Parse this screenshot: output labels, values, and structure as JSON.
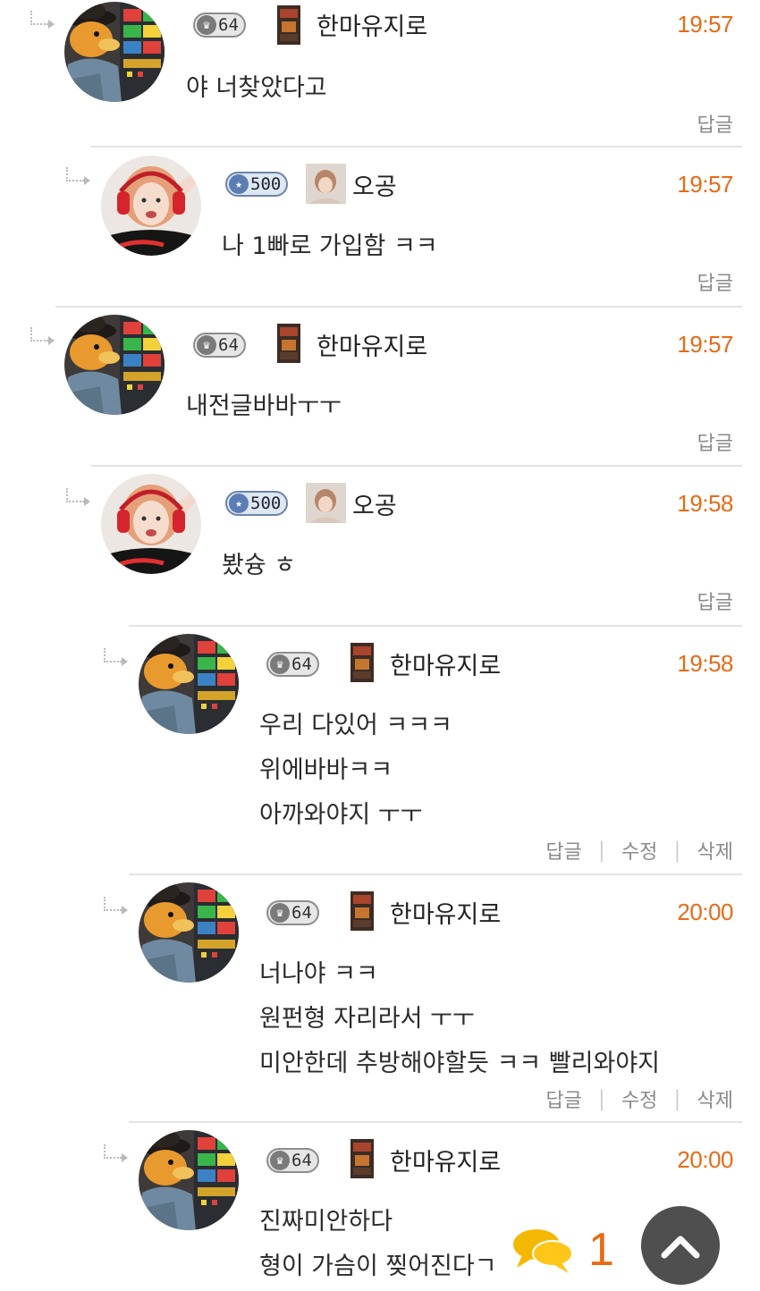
{
  "colors": {
    "accent": "#e86a16",
    "divider": "#e3e3e3",
    "meta_text": "#8a8a8a"
  },
  "comments": [
    {
      "user": "한마유지로",
      "level": "64",
      "level_style": "grey",
      "avatar": "duck-avatar",
      "time": "19:57",
      "lines": [
        "야 너찾았다고"
      ],
      "actions": [
        "답글"
      ]
    },
    {
      "user": "오공",
      "level": "500",
      "level_style": "blue",
      "avatar": "girl-avatar",
      "time": "19:57",
      "lines": [
        "나 1빠로 가입함 ㅋㅋ"
      ],
      "actions": [
        "답글"
      ]
    },
    {
      "user": "한마유지로",
      "level": "64",
      "level_style": "grey",
      "avatar": "duck-avatar",
      "time": "19:57",
      "lines": [
        "내전글바바ㅜㅜ"
      ],
      "actions": [
        "답글"
      ]
    },
    {
      "user": "오공",
      "level": "500",
      "level_style": "blue",
      "avatar": "girl-avatar",
      "time": "19:58",
      "lines": [
        "봤슝 ㅎ"
      ],
      "actions": [
        "답글"
      ]
    },
    {
      "user": "한마유지로",
      "level": "64",
      "level_style": "grey",
      "avatar": "duck-avatar",
      "time": "19:58",
      "lines": [
        "우리 다있어 ㅋㅋㅋ",
        "위에바바ㅋㅋ",
        "아까와야지 ㅜㅜ"
      ],
      "actions": [
        "답글",
        "수정",
        "삭제"
      ]
    },
    {
      "user": "한마유지로",
      "level": "64",
      "level_style": "grey",
      "avatar": "duck-avatar",
      "time": "20:00",
      "lines": [
        "너나야 ㅋㅋ",
        "원펀형 자리라서 ㅜㅜ",
        "미안한데 추방해야할듯 ㅋㅋ 빨리와야지"
      ],
      "actions": [
        "답글",
        "수정",
        "삭제"
      ]
    },
    {
      "user": "한마유지로",
      "level": "64",
      "level_style": "grey",
      "avatar": "duck-avatar",
      "time": "20:00",
      "lines": [
        "진짜미안하다",
        "형이 가슴이 찢어진다ㄱ"
      ],
      "actions": []
    }
  ],
  "floating": {
    "chat_icon": "chat-bubbles-icon",
    "chat_count": "1",
    "scroll_icon": "chevron-up-icon"
  }
}
